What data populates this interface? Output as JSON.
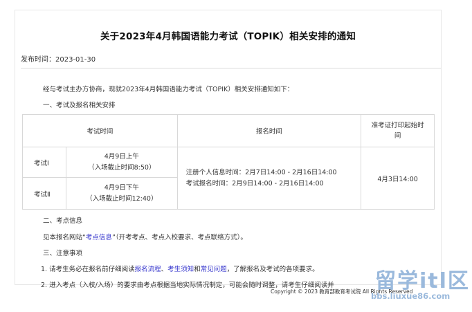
{
  "article": {
    "title": "关于2023年4月韩国语能力考试（TOPIK）相关安排的通知",
    "publish_label": "发布时间：",
    "publish_date": "2023-01-30",
    "intro": "经与考试主办方协商，现就2023年4月韩国语能力考试（TOPIK）相关安排通知如下：",
    "section1_title": "一、考试及报名相关安排",
    "table": {
      "headers": [
        "考试时间",
        "报名时间",
        "准考证打印起始时间"
      ],
      "rows": [
        {
          "level": "考试Ⅰ",
          "time_line1": "4月9日上午",
          "time_line2": "（入场截止时间8:50）"
        },
        {
          "level": "考试Ⅱ",
          "time_line1": "4月9日下午",
          "time_line2": "（入场截止时间12:40）"
        }
      ],
      "registration_line1": "注册个人信息时间：2月7日14:00 - 2月16日14:00",
      "registration_line2": "考试报名时间：2月9日14:00 - 2月16日14:00",
      "admission_print": "4月3日14:00"
    },
    "section2_title": "二、考点信息",
    "site_prefix": "见本报名网站“",
    "site_link": "考点信息",
    "site_suffix": "”（开考考点、考点入校要求、考点联络方式）。",
    "section3_title": "三、注意事项",
    "note1_prefix": "1. 请考生务必在报名前仔细阅读",
    "note1_link1": "报名流程",
    "note1_sep1": "、",
    "note1_link2": "考生须知",
    "note1_sep2": "和",
    "note1_link3": "常见问题",
    "note1_suffix": "，了解报名及考试的各项要求。",
    "note2": "2. 进入考点（入校/入场）的要求由考点根据当地实际情况制定，可能会随时调整，请考生仔细阅读并",
    "copyright": "Copyright © 2023 教育部教育考试院 All Rights Reserved"
  },
  "watermark": {
    "big": "留学itl区",
    "small": "bbs.liuxue86.com"
  }
}
